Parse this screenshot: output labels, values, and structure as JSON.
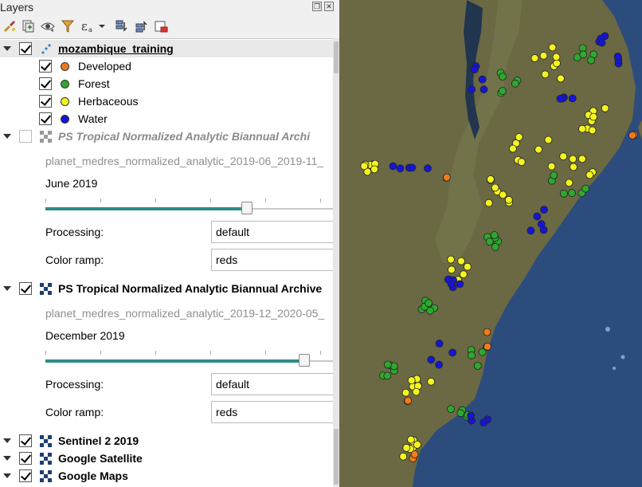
{
  "panel": {
    "title": "Layers",
    "toolbar": [
      {
        "name": "style-icon"
      },
      {
        "name": "add-group-icon"
      },
      {
        "name": "visibility-icon"
      },
      {
        "name": "filter-icon"
      },
      {
        "name": "expression-filter-icon"
      },
      {
        "name": "expand-all-icon"
      },
      {
        "name": "collapse-all-icon"
      },
      {
        "name": "remove-layer-icon"
      }
    ]
  },
  "layers": {
    "training": {
      "name": "mozambique_training",
      "checked": true,
      "classes": [
        {
          "label": "Developed",
          "color": "#f07b1b"
        },
        {
          "label": "Forest",
          "color": "#2ea82e"
        },
        {
          "label": "Herbaceous",
          "color": "#f5f51e"
        },
        {
          "label": "Water",
          "color": "#1515d6"
        }
      ]
    },
    "june": {
      "name": "PS Tropical Normalized Analytic Biannual Archi",
      "checked": false,
      "mosaic": "planet_medres_normalized_analytic_2019-06_2019-11_",
      "date": "June 2019",
      "slider_fraction": 0.7,
      "processing_label": "Processing:",
      "processing_value": "default",
      "ramp_label": "Color ramp:",
      "ramp_value": "reds"
    },
    "december": {
      "name": "PS Tropical Normalized Analytic Biannual Archive",
      "checked": true,
      "mosaic": "planet_medres_normalized_analytic_2019-12_2020-05_",
      "date": "December 2019",
      "slider_fraction": 0.9,
      "processing_label": "Processing:",
      "processing_value": "default",
      "ramp_label": "Color ramp:",
      "ramp_value": "reds"
    },
    "basemaps": [
      {
        "name": "Sentinel 2 2019",
        "checked": true
      },
      {
        "name": "Google Satellite",
        "checked": true
      },
      {
        "name": "Google Maps",
        "checked": true
      }
    ]
  },
  "map": {
    "land_color": "#6b6a45",
    "ocean_color": "#2a4a7c",
    "point_counts": {
      "developed": 10,
      "forest": 45,
      "herbaceous": 70,
      "water": 40
    }
  }
}
